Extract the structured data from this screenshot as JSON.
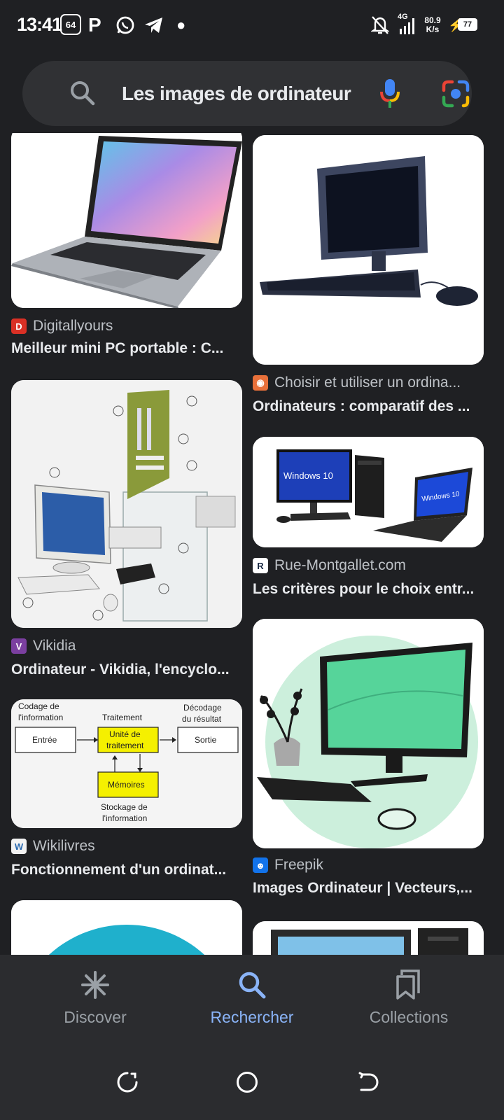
{
  "status_bar": {
    "time": "13:41",
    "network": "4G",
    "speed_value": "80.9",
    "speed_unit": "K/s",
    "battery": "77"
  },
  "search": {
    "query": "Les images de ordinateur"
  },
  "results": [
    {
      "source": "Digitallyours",
      "title": "Meilleur mini PC portable : C...",
      "favicon_color": "#d93025"
    },
    {
      "source": "Choisir et utiliser un ordina...",
      "title": "Ordinateurs : comparatif des ...",
      "favicon_color": "#e8703a"
    },
    {
      "source": "Vikidia",
      "title": "Ordinateur - Vikidia, l'encyclo...",
      "favicon_color": "#7b3fa0"
    },
    {
      "source": "Rue-Montgallet.com",
      "title": "Les critères pour le choix entr...",
      "favicon_color": "#ffffff"
    },
    {
      "source": "Wikilivres",
      "title": "Fonctionnement d'un ordinat...",
      "favicon_color": "#f2f2f2"
    },
    {
      "source": "Freepik",
      "title": "Images Ordinateur | Vecteurs,...",
      "favicon_color": "#1273eb"
    }
  ],
  "diagram": {
    "codage": [
      "Codage de",
      "l'information"
    ],
    "traitement": "Traitement",
    "decodage": [
      "Décodage",
      "du résultat"
    ],
    "entree": "Entrée",
    "unite": [
      "Unité de",
      "traitement"
    ],
    "sortie": "Sortie",
    "memoires": "Mémoires",
    "stockage": [
      "Stockage de",
      "l'information"
    ]
  },
  "windows_label": "Windows 10",
  "nav": {
    "discover": "Discover",
    "search": "Rechercher",
    "collections": "Collections"
  },
  "colors": {
    "background": "#1f2023",
    "search_bar": "#303134",
    "accent": "#8ab4f8"
  }
}
